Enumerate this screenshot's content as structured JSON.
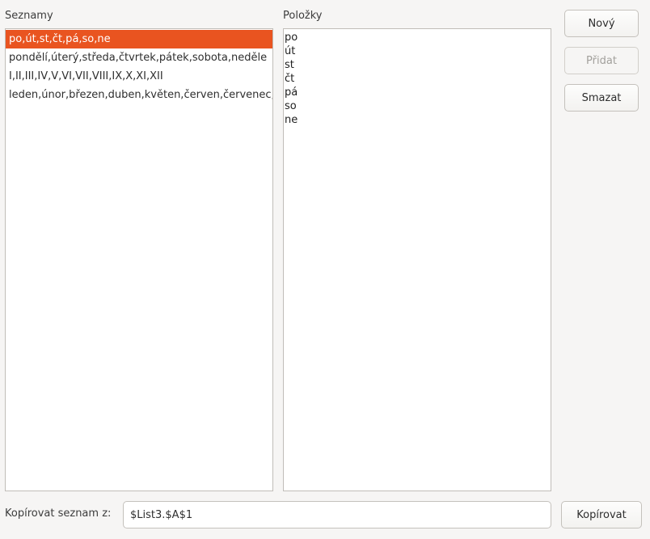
{
  "labels": {
    "lists": "Seznamy",
    "entries": "Položky",
    "copy_from": "Kopírovat seznam z:"
  },
  "lists": [
    {
      "text": "po,út,st,čt,pá,so,ne",
      "selected": true
    },
    {
      "text": "pondělí,úterý,středa,čtvrtek,pátek,sobota,neděle",
      "selected": false
    },
    {
      "text": "I,II,III,IV,V,VI,VII,VIII,IX,X,XI,XII",
      "selected": false
    },
    {
      "text": "leden,únor,březen,duben,květen,červen,červenec,srpen,září,říjen,listopad,prosinec",
      "selected": false
    }
  ],
  "entries": [
    "po",
    "út",
    "st",
    "čt",
    "pá",
    "so",
    "ne"
  ],
  "buttons": {
    "new": "Nový",
    "add": "Přidat",
    "delete": "Smazat",
    "copy": "Kopírovat"
  },
  "copy_input": {
    "value": "$List3.$A$1"
  },
  "colors": {
    "selection": "#e95420"
  }
}
